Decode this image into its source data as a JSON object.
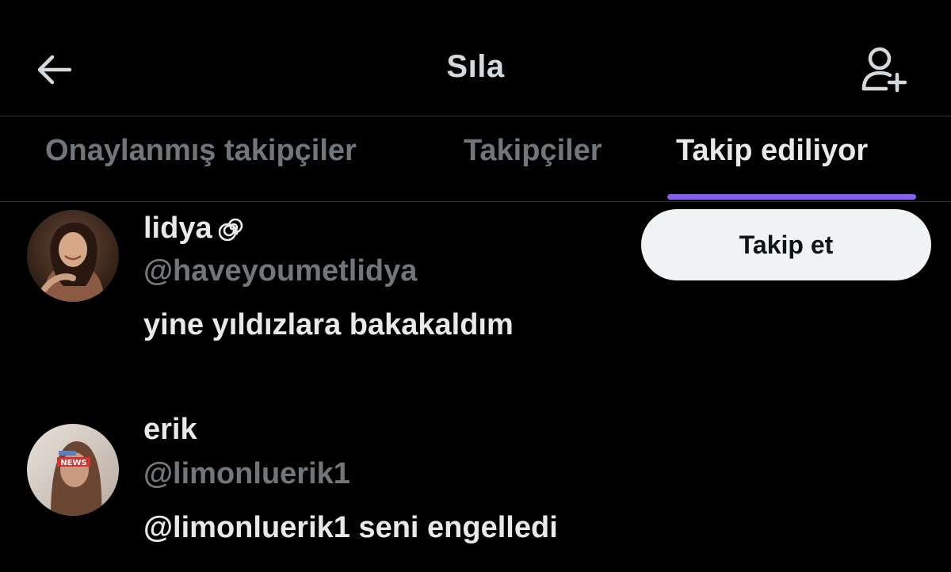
{
  "header": {
    "title": "Sıla",
    "back_icon": "arrow-left-icon",
    "add_icon": "user-plus-icon"
  },
  "tabs": [
    {
      "label": "Onaylanmış takipçiler",
      "active": false
    },
    {
      "label": "Takipçiler",
      "active": false
    },
    {
      "label": "Takip ediliyor",
      "active": true
    }
  ],
  "colors": {
    "background": "#000000",
    "text_primary": "#e7e9ea",
    "text_secondary": "#71767b",
    "accent_indicator": "#8a5cf6",
    "button_bg": "#eff3f4"
  },
  "users": [
    {
      "name": "lidya",
      "badge_icon": "spiral-icon",
      "handle": "@haveyoumetlidya",
      "bio": "yine yıldızlara bakakaldım",
      "button_label": "Takip et"
    },
    {
      "name": "erik",
      "handle": "@limonluerik1",
      "bio": "@limonluerik1 seni engelledi",
      "avatar_overlay_text": "NEWS"
    }
  ]
}
